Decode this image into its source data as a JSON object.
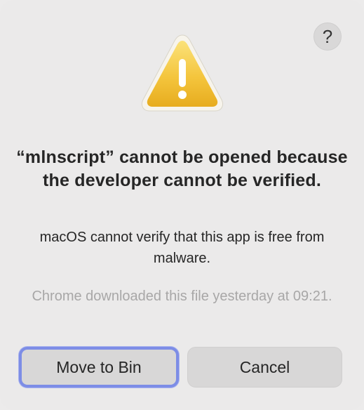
{
  "dialog": {
    "help_label": "?",
    "title": "“mlnscript” cannot be opened because the developer cannot be verified.",
    "message": "macOS cannot verify that this app is free from malware.",
    "note": "Chrome downloaded this file yesterday at 09:21.",
    "buttons": {
      "move_to_bin": "Move to Bin",
      "cancel": "Cancel"
    },
    "icon": "warning-triangle-icon",
    "colors": {
      "warning_yellow": "#f4c53d",
      "focus_ring": "#7d8de6"
    }
  }
}
